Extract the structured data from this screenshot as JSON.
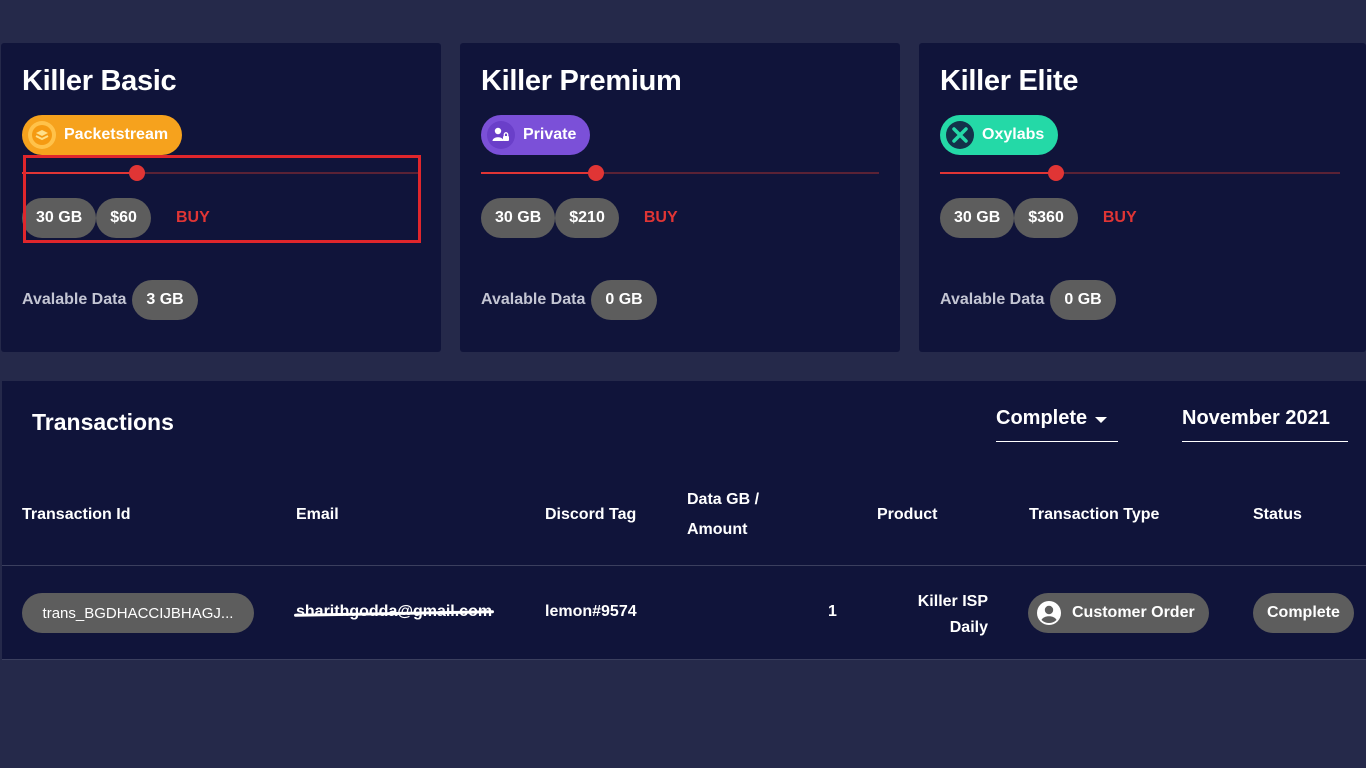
{
  "plans": [
    {
      "title": "Killer Basic",
      "provider": "Packetstream",
      "provider_icon": "packetstream-icon",
      "provider_color": "#f6a21d",
      "slider_fraction": 0.29,
      "data_pill": "30 GB",
      "price_pill": "$60",
      "buy_label": "BUY",
      "available_label": "Avalable Data",
      "available_value": "3 GB"
    },
    {
      "title": "Killer Premium",
      "provider": "Private",
      "provider_icon": "private-user-lock-icon",
      "provider_color": "#7b50d8",
      "slider_fraction": 0.29,
      "data_pill": "30 GB",
      "price_pill": "$210",
      "buy_label": "BUY",
      "available_label": "Avalable Data",
      "available_value": "0 GB"
    },
    {
      "title": "Killer Elite",
      "provider": "Oxylabs",
      "provider_icon": "oxylabs-icon",
      "provider_color": "#24d9a7",
      "slider_fraction": 0.29,
      "data_pill": "30 GB",
      "price_pill": "$360",
      "buy_label": "BUY",
      "available_label": "Avalable Data",
      "available_value": "0 GB"
    }
  ],
  "transactions": {
    "title": "Transactions",
    "status_filter": "Complete",
    "month_filter": "November 2021",
    "columns": {
      "transaction_id": "Transaction Id",
      "email": "Email",
      "discord_tag": "Discord Tag",
      "data_amount_line1": "Data GB /",
      "data_amount_line2": "Amount",
      "product": "Product",
      "transaction_type": "Transaction Type",
      "status": "Status"
    },
    "rows": [
      {
        "transaction_id": "trans_BGDHACCIJBHAGJ...",
        "email": "sharithgodda@gmail.com",
        "discord_tag": "lemon#9574",
        "data_amount": "1",
        "product_line1": "Killer ISP",
        "product_line2": "Daily",
        "transaction_type": "Customer Order",
        "status": "Complete"
      }
    ]
  },
  "colors": {
    "background": "#25294a",
    "panel": "#10143a",
    "accent_red": "#e03535",
    "pill_gray": "#5d5d5d"
  }
}
